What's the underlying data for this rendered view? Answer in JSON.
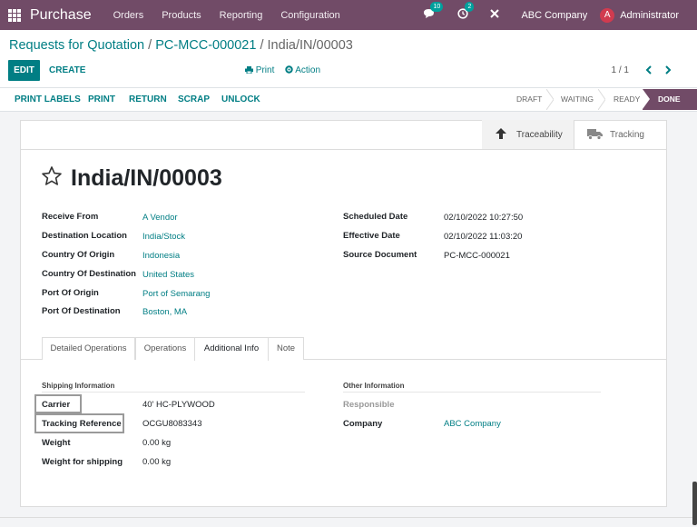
{
  "navbar": {
    "brand": "Purchase",
    "menu": [
      "Orders",
      "Products",
      "Reporting",
      "Configuration"
    ],
    "messages_count": "10",
    "activities_count": "2",
    "company": "ABC Company",
    "user_initial": "A",
    "user_name": "Administrator"
  },
  "breadcrumb": {
    "root": "Requests for Quotation",
    "sep1": " / ",
    "parent": "PC-MCC-000021",
    "sep2": " / ",
    "current": "India/IN/00003"
  },
  "toolbar": {
    "edit_label": "EDIT",
    "create_label": "CREATE",
    "print_label": "Print",
    "action_label": "Action",
    "pager": "1 / 1"
  },
  "statusbar": {
    "buttons": [
      "PRINT LABELS",
      "PRINT",
      "RETURN",
      "SCRAP",
      "UNLOCK"
    ],
    "stages": [
      "DRAFT",
      "WAITING",
      "READY",
      "DONE"
    ],
    "current_stage": "DONE"
  },
  "smart_buttons": {
    "traceability": "Traceability",
    "tracking": "Tracking"
  },
  "record": {
    "title": "India/IN/00003",
    "left_fields": [
      {
        "label": "Receive From",
        "value": "A Vendor"
      },
      {
        "label": "Destination Location",
        "value": "India/Stock"
      },
      {
        "label": "Country Of Origin",
        "value": "Indonesia"
      },
      {
        "label": "Country Of Destination",
        "value": "United States"
      },
      {
        "label": "Port Of Origin",
        "value": "Port of Semarang"
      },
      {
        "label": "Port Of Destination",
        "value": "Boston, MA"
      }
    ],
    "right_fields": [
      {
        "label": "Scheduled Date",
        "value": "02/10/2022 10:27:50"
      },
      {
        "label": "Effective Date",
        "value": "02/10/2022 11:03:20"
      },
      {
        "label": "Source Document",
        "value": "PC-MCC-000021"
      }
    ]
  },
  "tabs": {
    "items": [
      "Detailed Operations",
      "Operations",
      "Additional Info",
      "Note"
    ],
    "active": "Additional Info"
  },
  "additional_info": {
    "shipping_title": "Shipping Information",
    "shipping_fields": [
      {
        "label": "Carrier",
        "value": "40' HC-PLYWOOD"
      },
      {
        "label": "Tracking Reference",
        "value": "OCGU8083343"
      },
      {
        "label": "Weight",
        "value": "0.00 kg"
      },
      {
        "label": "Weight for shipping",
        "value": "0.00 kg"
      }
    ],
    "other_title": "Other Information",
    "other_fields": [
      {
        "label": "Responsible",
        "value": ""
      },
      {
        "label": "Company",
        "value": "ABC Company"
      }
    ]
  },
  "colors": {
    "brand": "#714B67",
    "accent": "#017e84",
    "badge": "#00A09D"
  }
}
